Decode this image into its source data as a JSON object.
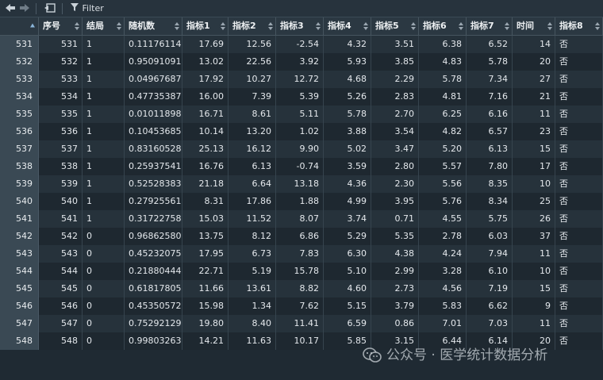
{
  "toolbar": {
    "filter_label": "Filter"
  },
  "colors": {
    "background": "#1f2a33",
    "header_bg": "#2b3842",
    "rowname_bg": "#3a4954",
    "odd_row": "#26323b",
    "even_row": "#1e2830"
  },
  "icons": [
    "back-arrow-icon",
    "forward-arrow-icon",
    "export-icon",
    "filter-icon",
    "sort-icon",
    "wechat-icon"
  ],
  "columns": [
    "序号",
    "结局",
    "随机数",
    "指标1",
    "指标2",
    "指标3",
    "指标4",
    "指标5",
    "指标6",
    "指标7",
    "时间",
    "指标8"
  ],
  "rows": [
    {
      "name": "531",
      "cells": [
        "531",
        "1",
        "0.111761147",
        "17.69",
        "12.56",
        "-2.54",
        "4.32",
        "3.51",
        "6.38",
        "6.52",
        "14",
        "否"
      ]
    },
    {
      "name": "532",
      "cells": [
        "532",
        "1",
        "0.950910913",
        "13.02",
        "22.56",
        "3.92",
        "5.93",
        "3.85",
        "4.83",
        "5.78",
        "20",
        "否"
      ]
    },
    {
      "name": "533",
      "cells": [
        "533",
        "1",
        "0.049676874",
        "17.92",
        "10.27",
        "12.72",
        "4.68",
        "2.29",
        "5.78",
        "7.34",
        "27",
        "否"
      ]
    },
    {
      "name": "534",
      "cells": [
        "534",
        "1",
        "0.477353874",
        "16.00",
        "7.39",
        "5.39",
        "5.26",
        "2.83",
        "4.81",
        "7.16",
        "21",
        "否"
      ]
    },
    {
      "name": "535",
      "cells": [
        "535",
        "1",
        "0.010118980",
        "16.71",
        "8.61",
        "5.11",
        "5.78",
        "2.70",
        "6.25",
        "6.16",
        "11",
        "否"
      ]
    },
    {
      "name": "536",
      "cells": [
        "536",
        "1",
        "0.104536856",
        "10.14",
        "13.20",
        "1.02",
        "3.88",
        "3.54",
        "4.82",
        "6.57",
        "23",
        "否"
      ]
    },
    {
      "name": "537",
      "cells": [
        "537",
        "1",
        "0.831605288",
        "25.13",
        "16.12",
        "9.90",
        "5.02",
        "3.47",
        "5.20",
        "6.13",
        "15",
        "否"
      ]
    },
    {
      "name": "538",
      "cells": [
        "538",
        "1",
        "0.259375417",
        "16.76",
        "6.13",
        "-0.74",
        "3.59",
        "2.80",
        "5.57",
        "7.80",
        "17",
        "否"
      ]
    },
    {
      "name": "539",
      "cells": [
        "539",
        "1",
        "0.525283833",
        "21.18",
        "6.64",
        "13.18",
        "4.36",
        "2.30",
        "5.56",
        "8.35",
        "10",
        "否"
      ]
    },
    {
      "name": "540",
      "cells": [
        "540",
        "1",
        "0.279255618",
        "8.31",
        "17.86",
        "1.88",
        "4.99",
        "3.95",
        "5.76",
        "8.34",
        "25",
        "否"
      ]
    },
    {
      "name": "541",
      "cells": [
        "541",
        "1",
        "0.317227581",
        "15.03",
        "11.52",
        "8.07",
        "3.74",
        "0.71",
        "4.55",
        "5.75",
        "26",
        "否"
      ]
    },
    {
      "name": "542",
      "cells": [
        "542",
        "0",
        "0.968625804",
        "13.75",
        "8.12",
        "6.86",
        "5.29",
        "5.35",
        "2.78",
        "6.03",
        "37",
        "否"
      ]
    },
    {
      "name": "543",
      "cells": [
        "543",
        "0",
        "0.452320752",
        "17.95",
        "6.73",
        "7.83",
        "6.30",
        "4.38",
        "4.24",
        "7.94",
        "11",
        "否"
      ]
    },
    {
      "name": "544",
      "cells": [
        "544",
        "0",
        "0.218804446",
        "22.71",
        "5.19",
        "15.78",
        "5.10",
        "2.99",
        "3.28",
        "6.10",
        "10",
        "否"
      ]
    },
    {
      "name": "545",
      "cells": [
        "545",
        "0",
        "0.618178050",
        "11.66",
        "13.61",
        "8.82",
        "4.60",
        "2.73",
        "4.56",
        "7.19",
        "15",
        "否"
      ]
    },
    {
      "name": "546",
      "cells": [
        "546",
        "0",
        "0.453505721",
        "15.98",
        "1.34",
        "7.62",
        "5.15",
        "3.79",
        "5.83",
        "6.62",
        "9",
        "否"
      ]
    },
    {
      "name": "547",
      "cells": [
        "547",
        "0",
        "0.752921296",
        "19.80",
        "8.40",
        "11.41",
        "6.59",
        "0.86",
        "7.01",
        "7.03",
        "11",
        "否"
      ]
    },
    {
      "name": "548",
      "cells": [
        "548",
        "0",
        "0.998032636",
        "14.21",
        "11.63",
        "10.17",
        "5.85",
        "3.15",
        "6.44",
        "6.14",
        "20",
        "否"
      ]
    }
  ],
  "watermark": {
    "text": "公众号 · 医学统计数据分析"
  }
}
